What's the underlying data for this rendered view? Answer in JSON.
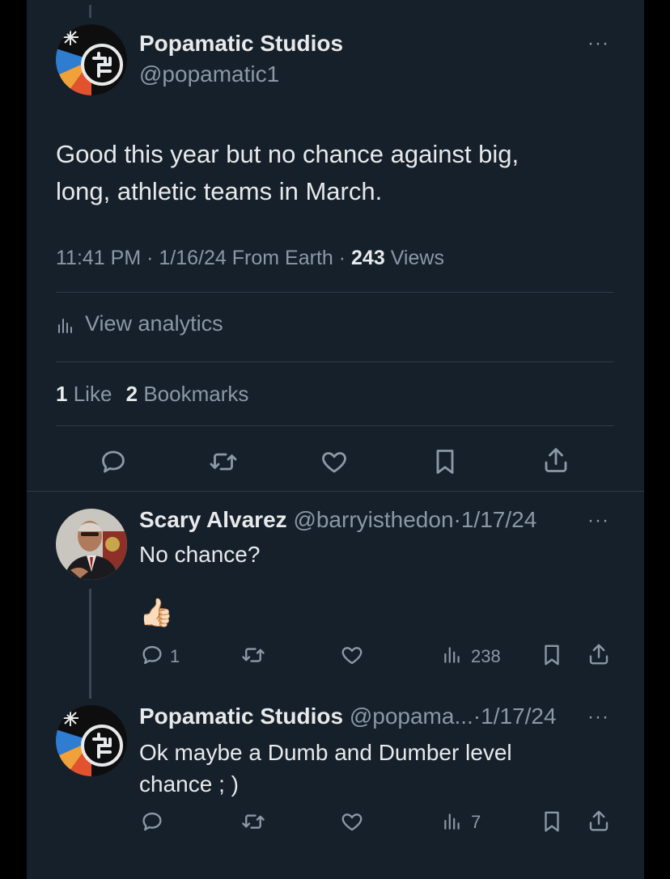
{
  "main_tweet": {
    "author_name": "Popamatic Studios",
    "author_handle": "@popamatic1",
    "text_line1": "Good this year but no chance against big,",
    "text_line2": "long, athletic teams in March.",
    "time": "11:41 PM",
    "date": "1/16/24",
    "source": "From Earth",
    "views_count": "243",
    "views_label": "Views",
    "analytics_label": "View analytics",
    "likes_count": "1",
    "likes_label": "Like",
    "bookmarks_count": "2",
    "bookmarks_label": "Bookmarks"
  },
  "reply1": {
    "author_name": "Scary Alvarez",
    "author_handle": "@barryisthedon",
    "date": "1/17/24",
    "text": "No chance?",
    "emoji": "👍🏻",
    "reply_count": "1",
    "views_count": "238"
  },
  "reply2": {
    "author_name": "Popamatic Studios",
    "author_handle": "@popama...",
    "date": "1/17/24",
    "text_line1": "Ok maybe a Dumb and Dumber level",
    "text_line2": "chance ; )",
    "views_count": "7"
  },
  "separator": "·",
  "more_glyph": "···",
  "colors": {
    "background": "#16202a",
    "outer": "#000000",
    "text": "#e7e9ea",
    "muted": "#8b98a5",
    "divider": "#2f3b47"
  },
  "icons": [
    "comment-icon",
    "retweet-icon",
    "heart-icon",
    "bookmark-icon",
    "share-icon",
    "analytics-icon",
    "more-icon"
  ]
}
